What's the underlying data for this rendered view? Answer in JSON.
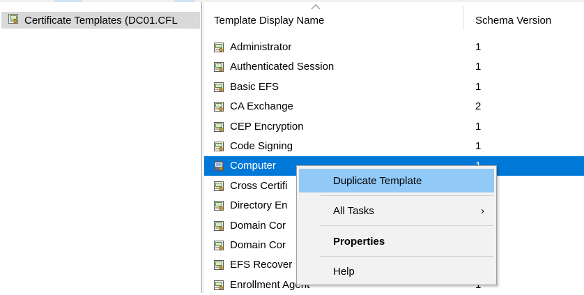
{
  "tree": {
    "root_label": "Certificate Templates (DC01.CFL"
  },
  "list": {
    "columns": [
      "Template Display Name",
      "Schema Version"
    ],
    "rows": [
      {
        "name": "Administrator",
        "version": "1"
      },
      {
        "name": "Authenticated Session",
        "version": "1"
      },
      {
        "name": "Basic EFS",
        "version": "1"
      },
      {
        "name": "CA Exchange",
        "version": "2"
      },
      {
        "name": "CEP Encryption",
        "version": "1"
      },
      {
        "name": "Code Signing",
        "version": "1"
      },
      {
        "name": "Computer",
        "version": "1",
        "selected": true
      },
      {
        "name": "Cross Certifi",
        "version": ""
      },
      {
        "name": "Directory En",
        "version": ""
      },
      {
        "name": "Domain Cor",
        "version": ""
      },
      {
        "name": "Domain Cor",
        "version": ""
      },
      {
        "name": "EFS Recover",
        "version": ""
      },
      {
        "name": "Enrollment Agent",
        "version": "1"
      }
    ]
  },
  "context_menu": {
    "items": [
      {
        "label": "Duplicate Template",
        "highlighted": true
      },
      {
        "label": "All Tasks",
        "submenu": true
      },
      {
        "label": "Properties",
        "bold": true
      },
      {
        "label": "Help"
      }
    ],
    "submenu_glyph": "›"
  },
  "colors": {
    "selection": "#0078d7",
    "menu_highlight": "#91c9f7",
    "menu_background": "#f2f2f2",
    "tree_selection": "#d9d9d9"
  },
  "icons": {
    "template": "certificate-template-icon",
    "sort": "sort-ascending-icon",
    "submenu": "chevron-right-icon"
  }
}
